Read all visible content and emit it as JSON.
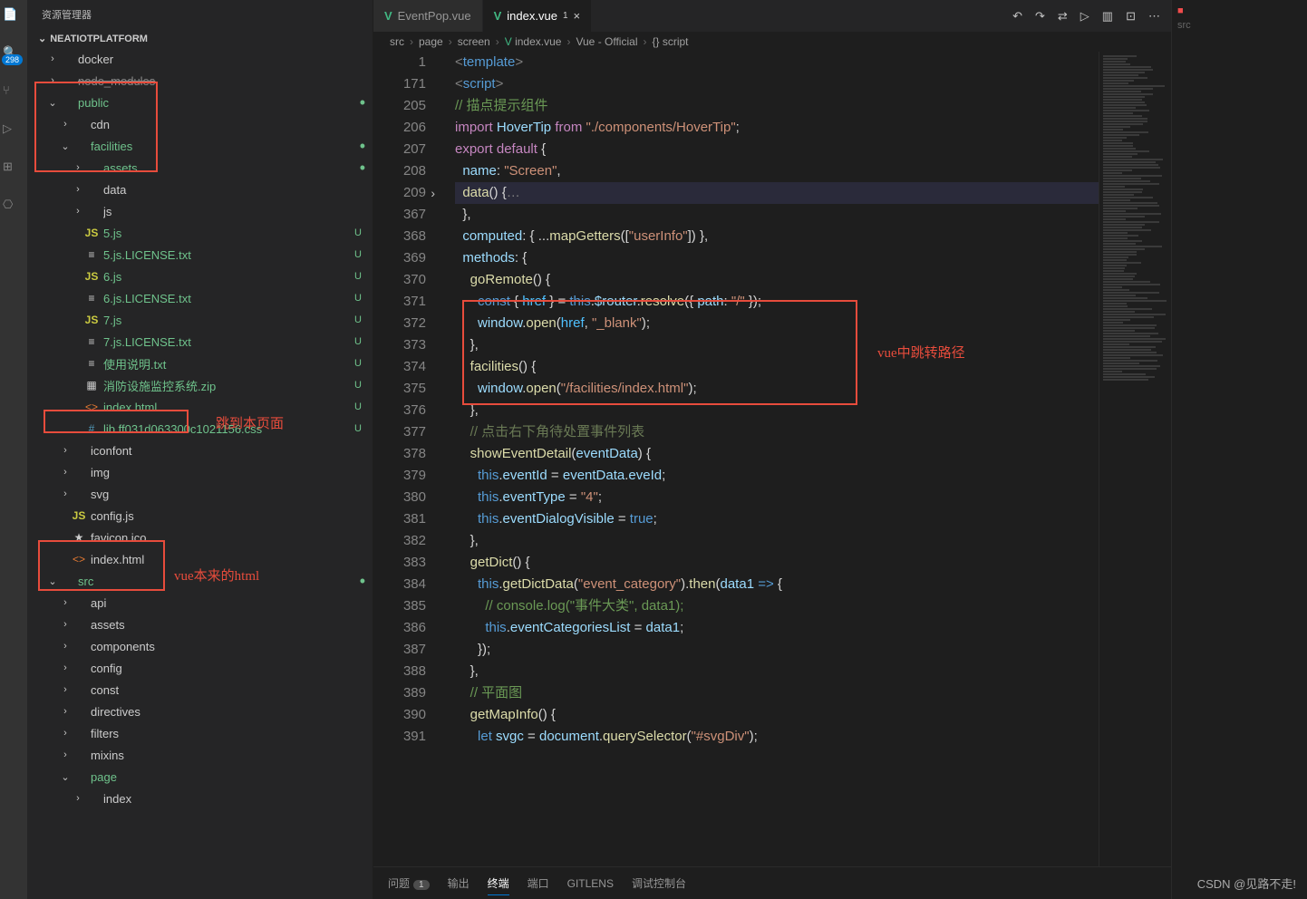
{
  "sidebar_title": "资源管理器",
  "project_name": "NEATIOTPLATFORM",
  "activity_badge": "298",
  "tree": [
    {
      "indent": 1,
      "chev": "›",
      "icon": "",
      "label": "docker",
      "cls": ""
    },
    {
      "indent": 1,
      "chev": "›",
      "icon": "",
      "label": "node_modules",
      "cls": "dim"
    },
    {
      "indent": 1,
      "chev": "⌄",
      "icon": "",
      "label": "public",
      "cls": "mod",
      "dot": true
    },
    {
      "indent": 2,
      "chev": "›",
      "icon": "",
      "label": "cdn",
      "cls": ""
    },
    {
      "indent": 2,
      "chev": "⌄",
      "icon": "",
      "label": "facilities",
      "cls": "mod",
      "dot": true
    },
    {
      "indent": 3,
      "chev": "›",
      "icon": "",
      "label": "assets",
      "cls": "mod",
      "dot": true
    },
    {
      "indent": 3,
      "chev": "›",
      "icon": "",
      "label": "data",
      "cls": ""
    },
    {
      "indent": 3,
      "chev": "›",
      "icon": "",
      "label": "js",
      "cls": ""
    },
    {
      "indent": 3,
      "chev": "",
      "icon": "JS",
      "iconcls": "js-ic",
      "label": "5.js",
      "cls": "untracked",
      "status": "U"
    },
    {
      "indent": 3,
      "chev": "",
      "icon": "≡",
      "label": "5.js.LICENSE.txt",
      "cls": "untracked",
      "status": "U"
    },
    {
      "indent": 3,
      "chev": "",
      "icon": "JS",
      "iconcls": "js-ic",
      "label": "6.js",
      "cls": "untracked",
      "status": "U"
    },
    {
      "indent": 3,
      "chev": "",
      "icon": "≡",
      "label": "6.js.LICENSE.txt",
      "cls": "untracked",
      "status": "U"
    },
    {
      "indent": 3,
      "chev": "",
      "icon": "JS",
      "iconcls": "js-ic",
      "label": "7.js",
      "cls": "untracked",
      "status": "U"
    },
    {
      "indent": 3,
      "chev": "",
      "icon": "≡",
      "label": "7.js.LICENSE.txt",
      "cls": "untracked",
      "status": "U"
    },
    {
      "indent": 3,
      "chev": "",
      "icon": "≡",
      "label": "使用说明.txt",
      "cls": "untracked",
      "status": "U"
    },
    {
      "indent": 3,
      "chev": "",
      "icon": "▦",
      "label": "消防设施监控系统.zip",
      "cls": "untracked",
      "status": "U"
    },
    {
      "indent": 3,
      "chev": "",
      "icon": "<>",
      "iconcls": "html-ic",
      "label": "index.html",
      "cls": "untracked",
      "status": "U"
    },
    {
      "indent": 3,
      "chev": "",
      "icon": "#",
      "iconcls": "css-ic",
      "label": "lib.ff031d063300c1021156.css",
      "cls": "untracked",
      "status": "U"
    },
    {
      "indent": 2,
      "chev": "›",
      "icon": "",
      "label": "iconfont",
      "cls": ""
    },
    {
      "indent": 2,
      "chev": "›",
      "icon": "",
      "label": "img",
      "cls": ""
    },
    {
      "indent": 2,
      "chev": "›",
      "icon": "",
      "label": "svg",
      "cls": ""
    },
    {
      "indent": 2,
      "chev": "",
      "icon": "JS",
      "iconcls": "js-ic",
      "label": "config.js",
      "cls": ""
    },
    {
      "indent": 2,
      "chev": "",
      "icon": "★",
      "label": "favicon.ico",
      "cls": ""
    },
    {
      "indent": 2,
      "chev": "",
      "icon": "<>",
      "iconcls": "html-ic",
      "label": "index.html",
      "cls": ""
    },
    {
      "indent": 1,
      "chev": "⌄",
      "icon": "",
      "label": "src",
      "cls": "mod",
      "dot": true
    },
    {
      "indent": 2,
      "chev": "›",
      "icon": "",
      "label": "api",
      "cls": ""
    },
    {
      "indent": 2,
      "chev": "›",
      "icon": "",
      "label": "assets",
      "cls": ""
    },
    {
      "indent": 2,
      "chev": "›",
      "icon": "",
      "label": "components",
      "cls": ""
    },
    {
      "indent": 2,
      "chev": "›",
      "icon": "",
      "label": "config",
      "cls": ""
    },
    {
      "indent": 2,
      "chev": "›",
      "icon": "",
      "label": "const",
      "cls": ""
    },
    {
      "indent": 2,
      "chev": "›",
      "icon": "",
      "label": "directives",
      "cls": ""
    },
    {
      "indent": 2,
      "chev": "›",
      "icon": "",
      "label": "filters",
      "cls": ""
    },
    {
      "indent": 2,
      "chev": "›",
      "icon": "",
      "label": "mixins",
      "cls": ""
    },
    {
      "indent": 2,
      "chev": "⌄",
      "icon": "",
      "label": "page",
      "cls": "mod"
    },
    {
      "indent": 3,
      "chev": "›",
      "icon": "",
      "label": "index",
      "cls": ""
    }
  ],
  "tabs": [
    {
      "icon": "V",
      "label": "EventPop.vue",
      "active": false
    },
    {
      "icon": "V",
      "label": "index.vue",
      "modified": "1",
      "active": true
    }
  ],
  "breadcrumb": [
    "src",
    "page",
    "screen",
    "index.vue",
    "Vue - Official",
    "{} script"
  ],
  "code_lines": [
    {
      "n": "1",
      "html": "<span class='angle'>&lt;</span><span class='tag'>template</span><span class='angle'>&gt;</span>"
    },
    {
      "n": "171",
      "html": "<span class='angle'>&lt;</span><span class='tag'>script</span><span class='angle'>&gt;</span>"
    },
    {
      "n": "205",
      "html": "<span class='cm'>// 描点提示组件</span>"
    },
    {
      "n": "206",
      "html": "<span class='kw'>import</span> <span class='var'>HoverTip</span> <span class='kw'>from</span> <span class='str'>\"./components/HoverTip\"</span>;"
    },
    {
      "n": "207",
      "html": "<span class='kw'>export</span> <span class='kw'>default</span> {"
    },
    {
      "n": "208",
      "html": "  <span class='var'>name</span>: <span class='str'>\"Screen\"</span>,"
    },
    {
      "n": "209",
      "hl": true,
      "fold": true,
      "html": "  <span class='fn'>data</span>() {<span class='angle'>…</span>"
    },
    {
      "n": "367",
      "html": "  },"
    },
    {
      "n": "368",
      "html": "  <span class='var'>computed</span>: { ...<span class='fn'>mapGetters</span>([<span class='str'>\"userInfo\"</span>]) },"
    },
    {
      "n": "369",
      "html": "  <span class='var'>methods</span>: {"
    },
    {
      "n": "370",
      "html": "    <span class='fn'>goRemote</span>() {"
    },
    {
      "n": "371",
      "html": "      <span class='tag'>const</span> { <span class='const2'>href</span> } = <span class='this'>this</span>.<span class='var'>$router</span>.<span class='fn'>resolve</span>({ <span class='var'>path</span>: <span class='str'>\"/\"</span> });"
    },
    {
      "n": "372",
      "html": "      <span class='var'>window</span>.<span class='fn'>open</span>(<span class='const2'>href</span>, <span class='str'>\"_blank\"</span>);"
    },
    {
      "n": "373",
      "html": "    },"
    },
    {
      "n": "374",
      "html": "    <span class='fn'>facilities</span>() {"
    },
    {
      "n": "375",
      "html": "      <span class='var'>window</span>.<span class='fn'>open</span>(<span class='str'>\"/facilities/index.html\"</span>);"
    },
    {
      "n": "376",
      "html": "    },"
    },
    {
      "n": "377",
      "html": "    <span class='cm2'>// 点击右下角待处置事件列表</span>"
    },
    {
      "n": "378",
      "html": "    <span class='fn'>showEventDetail</span>(<span class='var'>eventData</span>) {"
    },
    {
      "n": "379",
      "html": "      <span class='this'>this</span>.<span class='var'>eventId</span> = <span class='var'>eventData</span>.<span class='var'>eveId</span>;"
    },
    {
      "n": "380",
      "html": "      <span class='this'>this</span>.<span class='var'>eventType</span> = <span class='str'>\"4\"</span>;"
    },
    {
      "n": "381",
      "html": "      <span class='this'>this</span>.<span class='var'>eventDialogVisible</span> = <span class='num'>true</span>;"
    },
    {
      "n": "382",
      "html": "    },"
    },
    {
      "n": "383",
      "html": "    <span class='fn'>getDict</span>() {"
    },
    {
      "n": "384",
      "html": "      <span class='this'>this</span>.<span class='fn'>getDictData</span>(<span class='str'>\"event_category\"</span>).<span class='fn'>then</span>(<span class='var'>data1</span> <span class='tag'>=&gt;</span> {"
    },
    {
      "n": "385",
      "html": "        <span class='cm'>// console.log(\"事件大类\", data1);</span>"
    },
    {
      "n": "386",
      "html": "        <span class='this'>this</span>.<span class='var'>eventCategoriesList</span> = <span class='var'>data1</span>;"
    },
    {
      "n": "387",
      "html": "      });"
    },
    {
      "n": "388",
      "html": "    },"
    },
    {
      "n": "389",
      "html": "    <span class='cm'>// 平面图</span>"
    },
    {
      "n": "390",
      "html": "    <span class='fn'>getMapInfo</span>() {"
    },
    {
      "n": "391",
      "html": "      <span class='tag'>let</span> <span class='var'>svgc</span> = <span class='var'>document</span>.<span class='fn'>querySelector</span>(<span class='str'>\"#svgDiv\"</span>);"
    }
  ],
  "panel_tabs": [
    {
      "label": "问题",
      "badge": "1"
    },
    {
      "label": "输出"
    },
    {
      "label": "终端",
      "active": true
    },
    {
      "label": "端口"
    },
    {
      "label": "GITLENS"
    },
    {
      "label": "调试控制台"
    }
  ],
  "rightbar_label": "src",
  "annotations": {
    "a1": "跳到本页面",
    "a2": "vue本来的html",
    "a3": "vue中跳转路径"
  },
  "watermark": "CSDN @见路不走!"
}
